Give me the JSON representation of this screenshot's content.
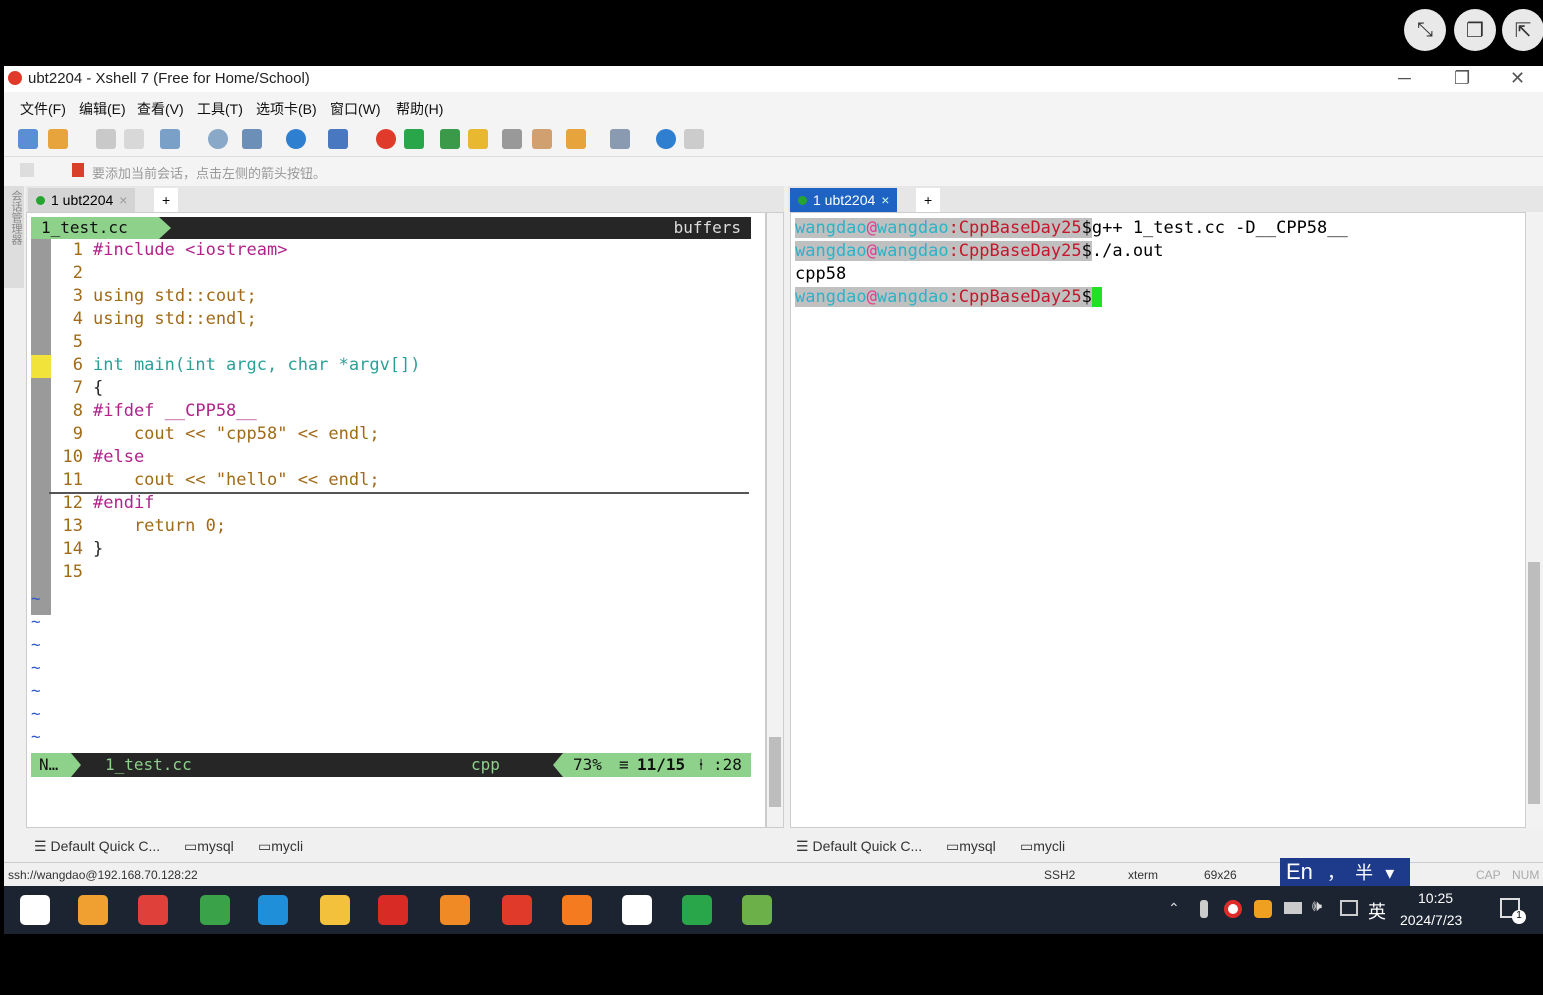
{
  "player_controls": {
    "minimize_icon": "collapse-icon",
    "copy_icon": "copy-icon",
    "open_icon": "external-icon"
  },
  "window": {
    "title": "ubt2204 - Xshell 7 (Free for Home/School)",
    "menu": [
      "文件(F)",
      "编辑(E)",
      "查看(V)",
      "工具(T)",
      "选项卡(B)",
      "窗口(W)",
      "帮助(H)"
    ],
    "hint": "要添加当前会话，点击左侧的箭头按钮。"
  },
  "left_tab": {
    "label": "1 ubt2204"
  },
  "right_tab": {
    "label": "1 ubt2204"
  },
  "side_strip": "会话管理器",
  "editor": {
    "filename": "1_test.cc",
    "buffers_label": "buffers",
    "lines": [
      {
        "n": "1",
        "code": "#include <iostream>"
      },
      {
        "n": "2",
        "code": ""
      },
      {
        "n": "3",
        "code": "using std::cout;"
      },
      {
        "n": "4",
        "code": "using std::endl;"
      },
      {
        "n": "5",
        "code": ""
      },
      {
        "n": "6",
        "code": "int main(int argc, char *argv[])"
      },
      {
        "n": "7",
        "code": "{"
      },
      {
        "n": "8",
        "code": "#ifdef __CPP58__"
      },
      {
        "n": "9",
        "code": "    cout << \"cpp58\" << endl;"
      },
      {
        "n": "10",
        "code": "#else"
      },
      {
        "n": "11",
        "code": "    cout << \"hello\" << endl;"
      },
      {
        "n": "12",
        "code": "#endif"
      },
      {
        "n": "13",
        "code": "    return 0;"
      },
      {
        "n": "14",
        "code": "}"
      },
      {
        "n": "15",
        "code": ""
      }
    ],
    "status": {
      "mode": "N…",
      "file": "1_test.cc",
      "filetype": "cpp",
      "percent": "73%",
      "position": "11/15",
      "column": ":28"
    }
  },
  "terminal": {
    "prompt_user": "wangdao",
    "prompt_at": "@",
    "prompt_host": "wangdao",
    "prompt_path": ":CppBaseDay25",
    "prompt_dollar": "$",
    "cmd1": "g++ 1_test.cc -D__CPP58__",
    "cmd2": "./a.out",
    "output": "cpp58"
  },
  "quickbar": {
    "default": "Default Quick C...",
    "mysql": "mysql",
    "mycli": "mycli"
  },
  "status_bar": {
    "connection": "ssh://wangdao@192.168.70.128:22",
    "protocol": "SSH2",
    "term": "xterm",
    "size": "69x26",
    "cap": "CAP",
    "num": "NUM"
  },
  "ime": {
    "lang": "En",
    "punct": "，",
    "width": "半"
  },
  "taskbar": {
    "time": "10:25",
    "date": "2024/7/23",
    "ime_label": "英",
    "notification_badge": "1",
    "apps": [
      {
        "name": "start-icon",
        "color": "#ffffff"
      },
      {
        "name": "search-app-icon",
        "color": "#f0a030"
      },
      {
        "name": "m-app-icon",
        "color": "#e0403a"
      },
      {
        "name": "chrome-icon",
        "color": "#3aa34a"
      },
      {
        "name": "copy-app-icon",
        "color": "#1e8fd8"
      },
      {
        "name": "folder-icon",
        "color": "#f3c13c"
      },
      {
        "name": "wps-icon",
        "color": "#d82b25"
      },
      {
        "name": "orange-app-icon",
        "color": "#f08a24"
      },
      {
        "name": "xshell-icon",
        "color": "#e03a2a"
      },
      {
        "name": "network-app-icon",
        "color": "#f47b20"
      },
      {
        "name": "typora-icon",
        "color": "#ffffff"
      },
      {
        "name": "green-app-icon",
        "color": "#2aa64a"
      },
      {
        "name": "notepad-icon",
        "color": "#6cb04a"
      }
    ]
  }
}
